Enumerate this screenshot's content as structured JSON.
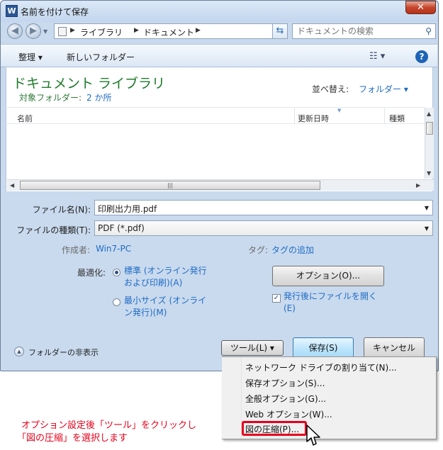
{
  "window": {
    "title": "名前を付けて保存",
    "app_icon_letter": "W",
    "close_symbol": "✕"
  },
  "nav": {
    "breadcrumb": [
      "ライブラリ",
      "ドキュメント"
    ],
    "search_placeholder": "ドキュメントの検索"
  },
  "toolbar": {
    "organize_label": "整理 ▾",
    "new_folder_label": "新しいフォルダー",
    "view_symbol": "☷ ▾",
    "help_symbol": "?"
  },
  "library": {
    "title": "ドキュメント ライブラリ",
    "subtitle_label": "対象フォルダー:",
    "subtitle_link": "2 か所",
    "sort_label": "並べ替え:",
    "sort_value": "フォルダー ▾",
    "columns": [
      "名前",
      "更新日時",
      "種類"
    ]
  },
  "form": {
    "filename_label": "ファイル名(N):",
    "filename_value": "印刷出力用.pdf",
    "filetype_label": "ファイルの種類(T):",
    "filetype_value": "PDF (*.pdf)",
    "author_label": "作成者:",
    "author_value": "Win7-PC",
    "tags_label": "タグ:",
    "tags_value": "タグの追加",
    "optimize_label": "最適化:",
    "radio_standard_line1": "標準 (オンライン発行",
    "radio_standard_line2": "および印刷)(A)",
    "radio_minimum_line1": "最小サイズ (オンライ",
    "radio_minimum_line2": "ン発行)(M)",
    "options_button": "オプション(O)...",
    "open_after_line1": "発行後にファイルを開く",
    "open_after_line2": "(E)",
    "open_after_checked": true
  },
  "footer": {
    "hide_folders_label": "フォルダーの非表示",
    "tools_button": "ツール(L)   ▾",
    "save_button": "保存(S)",
    "cancel_button": "キャンセル"
  },
  "tools_menu": {
    "items": [
      "ネットワーク ドライブの割り当て(N)...",
      "保存オプション(S)...",
      "全般オプション(G)...",
      "Web オプション(W)...",
      "図の圧縮(P)..."
    ]
  },
  "annotation": {
    "line1": "オプション設定後「ツール」をクリックし",
    "line2": "「図の圧縮」を選択します",
    "color": "#e8001c"
  }
}
